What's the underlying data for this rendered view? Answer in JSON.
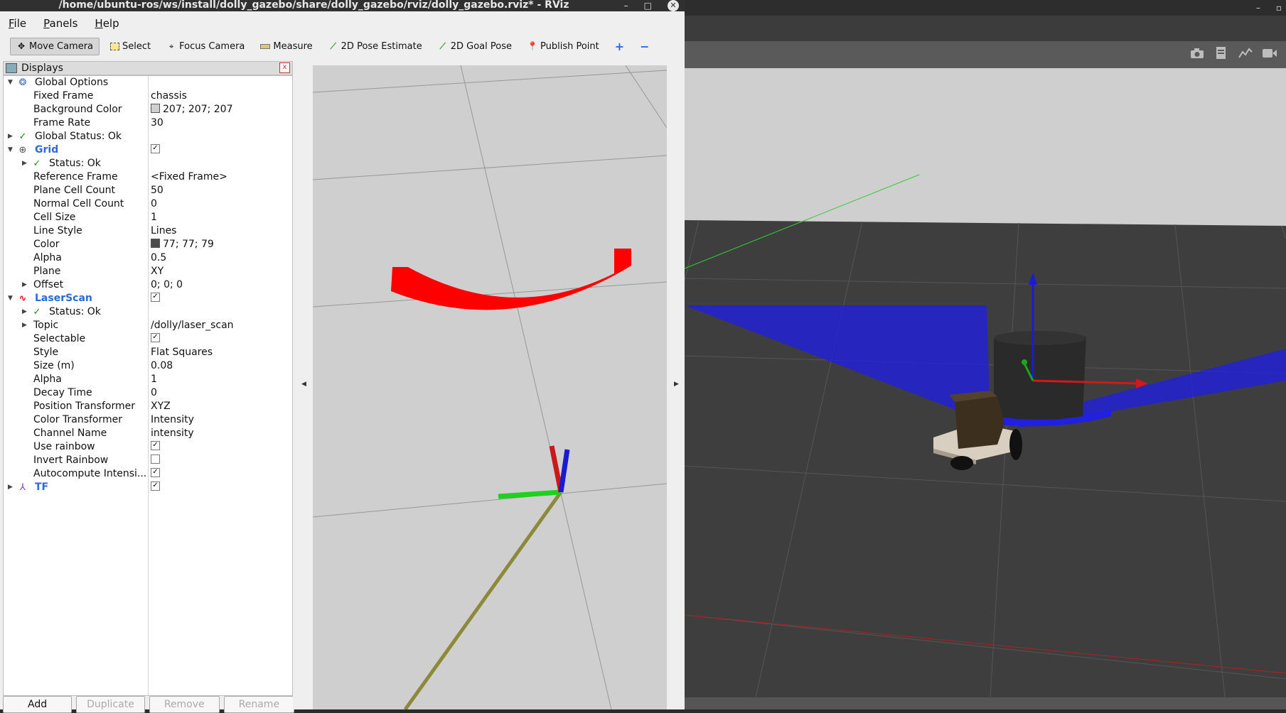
{
  "window": {
    "title": "/home/ubuntu-ros/ws/install/dolly_gazebo/share/dolly_gazebo/rviz/dolly_gazebo.rviz* - RViz",
    "minimize": "–",
    "maximize": "□",
    "close": "✕"
  },
  "menu": {
    "file": {
      "first": "F",
      "rest": "ile"
    },
    "panels": {
      "first": "P",
      "rest": "anels"
    },
    "help": {
      "first": "H",
      "rest": "elp"
    }
  },
  "toolbar": {
    "move_camera": "Move Camera",
    "select": "Select",
    "focus_camera": "Focus Camera",
    "measure": "Measure",
    "pose_estimate": "2D Pose Estimate",
    "goal_pose": "2D Goal Pose",
    "publish_point": "Publish Point",
    "add_tool": "+",
    "remove_tool": "−"
  },
  "displays": {
    "title": "Displays",
    "close": "x",
    "rows": {
      "global_options": {
        "name": "Global Options"
      },
      "fixed_frame": {
        "name": "Fixed Frame",
        "value": "chassis"
      },
      "background_color": {
        "name": "Background Color",
        "value": "207; 207; 207",
        "color": "#cfcfcf"
      },
      "frame_rate": {
        "name": "Frame Rate",
        "value": "30"
      },
      "global_status": {
        "name": "Global Status: Ok"
      },
      "grid": {
        "name": "Grid",
        "checked": "✓"
      },
      "grid_status": {
        "name": "Status: Ok"
      },
      "reference_frame": {
        "name": "Reference Frame",
        "value": "<Fixed Frame>"
      },
      "plane_cell_count": {
        "name": "Plane Cell Count",
        "value": "50"
      },
      "normal_cell_count": {
        "name": "Normal Cell Count",
        "value": "0"
      },
      "cell_size": {
        "name": "Cell Size",
        "value": "1"
      },
      "line_style": {
        "name": "Line Style",
        "value": "Lines"
      },
      "grid_color": {
        "name": "Color",
        "value": "77; 77; 79",
        "color": "#4d4d4f"
      },
      "grid_alpha": {
        "name": "Alpha",
        "value": "0.5"
      },
      "plane": {
        "name": "Plane",
        "value": "XY"
      },
      "offset": {
        "name": "Offset",
        "value": "0; 0; 0"
      },
      "laserscan": {
        "name": "LaserScan",
        "checked": "✓"
      },
      "laser_status": {
        "name": "Status: Ok"
      },
      "topic": {
        "name": "Topic",
        "value": "/dolly/laser_scan"
      },
      "selectable": {
        "name": "Selectable",
        "checked": "✓"
      },
      "style": {
        "name": "Style",
        "value": "Flat Squares"
      },
      "size": {
        "name": "Size (m)",
        "value": "0.08"
      },
      "laser_alpha": {
        "name": "Alpha",
        "value": "1"
      },
      "decay_time": {
        "name": "Decay Time",
        "value": "0"
      },
      "position_transformer": {
        "name": "Position Transformer",
        "value": "XYZ"
      },
      "color_transformer": {
        "name": "Color Transformer",
        "value": "Intensity"
      },
      "channel_name": {
        "name": "Channel Name",
        "value": "intensity"
      },
      "use_rainbow": {
        "name": "Use rainbow",
        "checked": "✓"
      },
      "invert_rainbow": {
        "name": "Invert Rainbow",
        "checked": ""
      },
      "autocompute": {
        "name": "Autocompute Intensi...",
        "checked": "✓"
      },
      "tf": {
        "name": "TF",
        "checked": "✓"
      }
    },
    "buttons": {
      "add": "Add",
      "duplicate": "Duplicate",
      "remove": "Remove",
      "rename": "Rename"
    }
  },
  "colors": {
    "scan_rviz": "#ff0000",
    "scan_gazebo": "#1f1fe6",
    "grid_bg": "#cfcfcf",
    "status_ok": "#1a8a1a",
    "display_name": "#2a6ad6"
  }
}
